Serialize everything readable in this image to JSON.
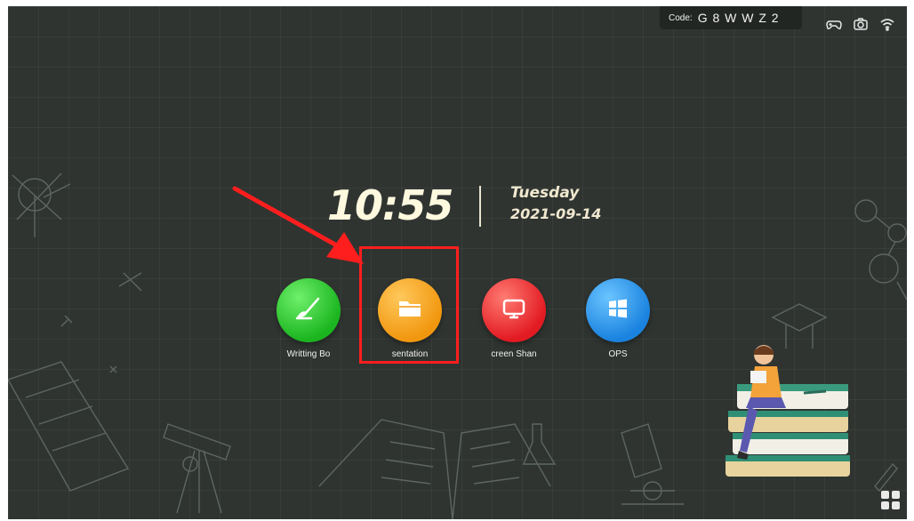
{
  "status_bar": {
    "code_label": "Code:",
    "code_value": "G 8 W W Z 2",
    "icons": [
      "gamepad-icon",
      "camera-icon",
      "wifi-icon"
    ]
  },
  "clock": {
    "time": "10:55",
    "day": "Tuesday",
    "date": "2021-09-14"
  },
  "apps": [
    {
      "label": "Writting Bo",
      "icon": "brush-icon",
      "color": "#1bb51f"
    },
    {
      "label": "sentation",
      "icon": "folder-icon",
      "color": "#f1970f"
    },
    {
      "label": "creen Shan",
      "icon": "screen-share-icon",
      "color": "#e21a22"
    },
    {
      "label": "OPS",
      "icon": "windows-icon",
      "color": "#1a83df"
    }
  ],
  "annotation": {
    "color": "#ff1e1e"
  },
  "theme": {
    "background": "#2f3431"
  }
}
